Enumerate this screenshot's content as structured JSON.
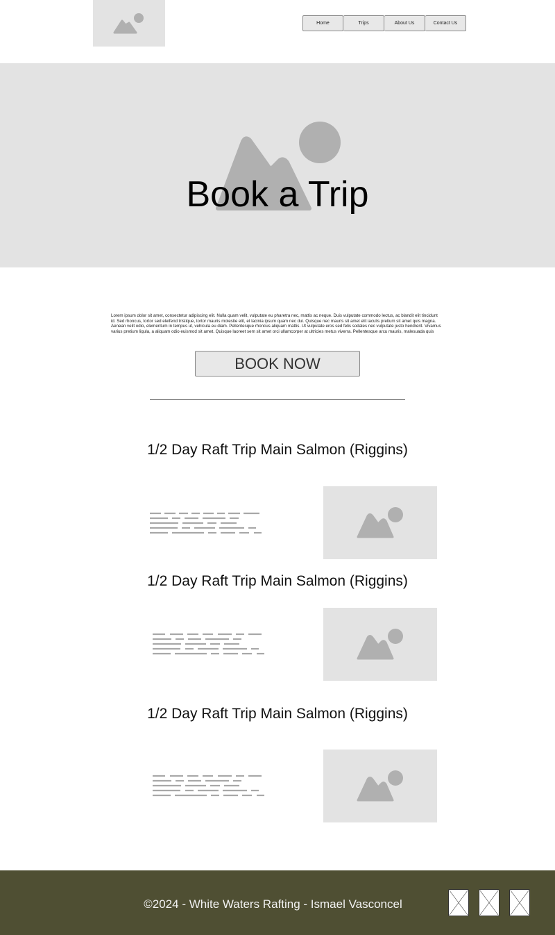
{
  "nav": {
    "items": [
      "Home",
      "Trips",
      "About Us",
      "Contact Us"
    ]
  },
  "hero": {
    "title": "Book a Trip"
  },
  "intro": {
    "text": "Lorem ipsum dolor sit amet, consectetur adipiscing elit. Nulla quam velit, vulputate eu pharetra nec, mattis ac neque. Duis vulputate commodo lectus, ac blandit elit tincidunt id. Sed rhoncus, tortor sed eleifend tristique, tortor mauris molestie elit, et lacinia ipsum quam nec dui. Quisque nec mauris sit amet elit iaculis pretium sit amet quis magna. Aenean velit odio, elementum in tempus ut, vehicula eu diam. Pellentesque rhoncus aliquam mattis. Ut vulputate eros sed felis sodales nec vulputate justo hendrerit. Vivamus varius pretium ligula, a aliquam odio euismod sit amet. Quisque laoreet sem sit amet orci ullamcorper at ultricies metus viverra. Pellentesque arcu mauris, malesuada quis ornare accumsan, blandit sed diam.",
    "button_label": "BOOK NOW"
  },
  "trips": [
    {
      "title": "1/2 Day Raft Trip Main Salmon (Riggins)"
    },
    {
      "title": "1/2 Day Raft Trip Main Salmon (Riggins)"
    },
    {
      "title": "1/2 Day Raft Trip Main Salmon (Riggins)"
    }
  ],
  "footer": {
    "copyright": "©2024 - White Waters Rafting - Ismael Vasconcel"
  },
  "colors": {
    "placeholder_bg": "#e3e3e3",
    "placeholder_shape": "#b0b0b0",
    "footer_bg": "#4f4f33"
  },
  "icons": {
    "logo": "image-placeholder-icon",
    "social": [
      "broken-image-icon",
      "broken-image-icon",
      "broken-image-icon"
    ]
  }
}
